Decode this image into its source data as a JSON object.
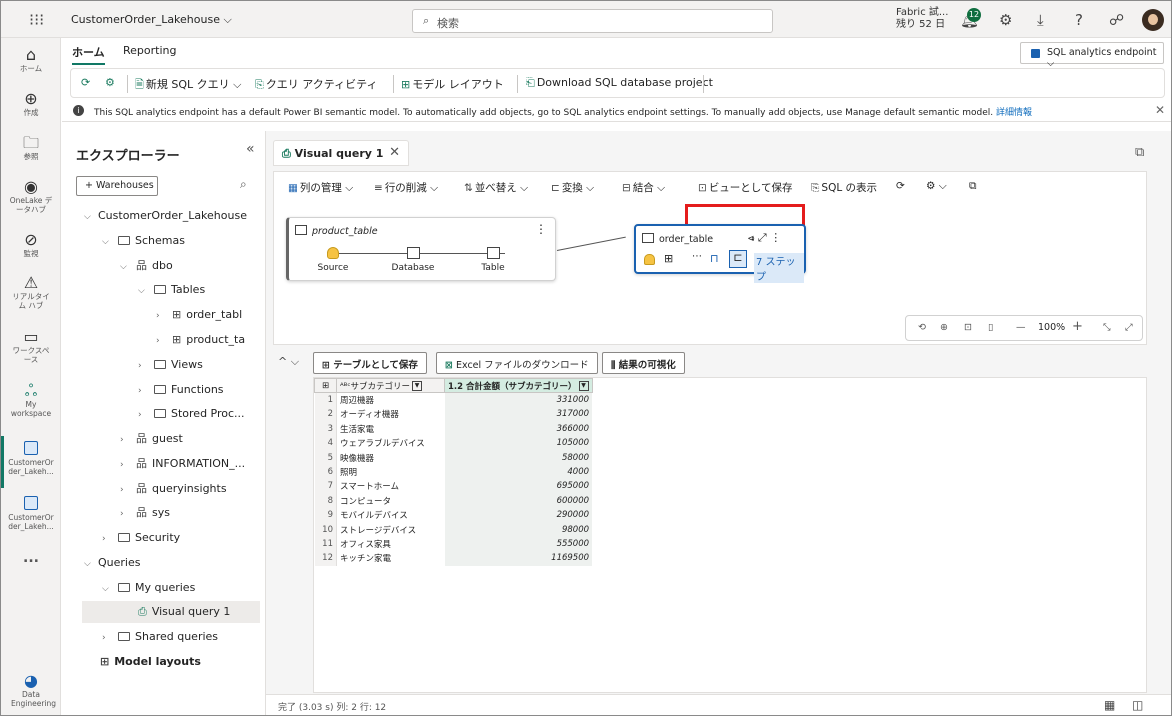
{
  "topbar": {
    "app_title": "CustomerOrder_Lakehouse",
    "search_placeholder": "検索",
    "trial_line1": "Fabric 試...",
    "trial_line2": "残り 52 日",
    "notification_count": "12"
  },
  "leftnav": {
    "items": [
      {
        "label": "ホーム",
        "icon": "home-icon"
      },
      {
        "label": "作成",
        "icon": "plus-circle-icon"
      },
      {
        "label": "参照",
        "icon": "folder-icon"
      },
      {
        "label": "OneLake データハブ",
        "icon": "onelake-icon"
      },
      {
        "label": "監視",
        "icon": "monitor-icon"
      },
      {
        "label": "リアルタイム ハブ",
        "icon": "realtime-icon"
      },
      {
        "label": "ワークスペース",
        "icon": "workspaces-icon"
      },
      {
        "label": "My workspace",
        "icon": "my-workspace-icon"
      },
      {
        "label": "CustomerOrder_Lakeh...",
        "icon": "lakehouse-icon"
      },
      {
        "label": "CustomerOrder_Lakeh...",
        "icon": "sql-endpoint-icon"
      },
      {
        "label": "...",
        "icon": "more-icon"
      },
      {
        "label": "Data Engineering",
        "icon": "data-engineering-icon"
      }
    ]
  },
  "ribbon": {
    "tabs": [
      "ホーム",
      "Reporting"
    ],
    "endpoint_selector": "SQL analytics endpoint",
    "toolbar": {
      "new_sql_query": "新規 SQL クエリ",
      "query_activity": "クエリ アクティビティ",
      "model_layout": "モデル レイアウト",
      "download_project": "Download SQL database project"
    }
  },
  "infobar": {
    "message": "This SQL analytics endpoint has a default Power BI semantic model. To automatically add objects, go to SQL analytics endpoint settings. To manually add objects, use Manage default semantic model.",
    "link": "詳細情報"
  },
  "explorer": {
    "title": "エクスプローラー",
    "warehouses_button": "Warehouses",
    "tree": {
      "lakehouse": "CustomerOrder_Lakehouse",
      "schemas": "Schemas",
      "dbo": "dbo",
      "tables": "Tables",
      "order_table": "order_tabl",
      "product_table": "product_ta",
      "views": "Views",
      "functions": "Functions",
      "stored_procs": "Stored Proc...",
      "guest": "guest",
      "information": "INFORMATION_...",
      "queryinsights": "queryinsights",
      "sys": "sys",
      "security": "Security",
      "queries": "Queries",
      "my_queries": "My queries",
      "visual_query": "Visual query 1",
      "shared_queries": "Shared queries",
      "model_layouts": "Model layouts"
    }
  },
  "editor": {
    "tab_title": "Visual query 1",
    "canvas_toolbar": {
      "manage_columns": "列の管理",
      "reduce_rows": "行の削減",
      "sort": "並べ替え",
      "transform": "変換",
      "combine": "結合",
      "save_as_view": "ビューとして保存",
      "show_sql": "SQL の表示"
    },
    "product_node": {
      "name": "product_table",
      "steps": [
        "Source",
        "Database",
        "Table"
      ]
    },
    "order_node": {
      "name": "order_table",
      "steps_label": "7 ステップ"
    },
    "zoom_level": "100%",
    "results_toolbar": {
      "save_as_table": "テーブルとして保存",
      "download_excel": "Excel ファイルのダウンロード",
      "visualize": "結果の可視化"
    },
    "grid": {
      "columns": [
        "サブカテゴリー",
        "1.2 合計金額（サブカテゴリー）"
      ],
      "rows": [
        {
          "n": "1",
          "cat": "周辺機器",
          "val": "331000"
        },
        {
          "n": "2",
          "cat": "オーディオ機器",
          "val": "317000"
        },
        {
          "n": "3",
          "cat": "生活家電",
          "val": "366000"
        },
        {
          "n": "4",
          "cat": "ウェアラブルデバイス",
          "val": "105000"
        },
        {
          "n": "5",
          "cat": "映像機器",
          "val": "58000"
        },
        {
          "n": "6",
          "cat": "照明",
          "val": "4000"
        },
        {
          "n": "7",
          "cat": "スマートホーム",
          "val": "695000"
        },
        {
          "n": "8",
          "cat": "コンピュータ",
          "val": "600000"
        },
        {
          "n": "9",
          "cat": "モバイルデバイス",
          "val": "290000"
        },
        {
          "n": "10",
          "cat": "ストレージデバイス",
          "val": "98000"
        },
        {
          "n": "11",
          "cat": "オフィス家具",
          "val": "555000"
        },
        {
          "n": "12",
          "cat": "キッチン家電",
          "val": "1169500"
        }
      ]
    },
    "status": "完了 (3.03 s)   列: 2   行: 12"
  }
}
